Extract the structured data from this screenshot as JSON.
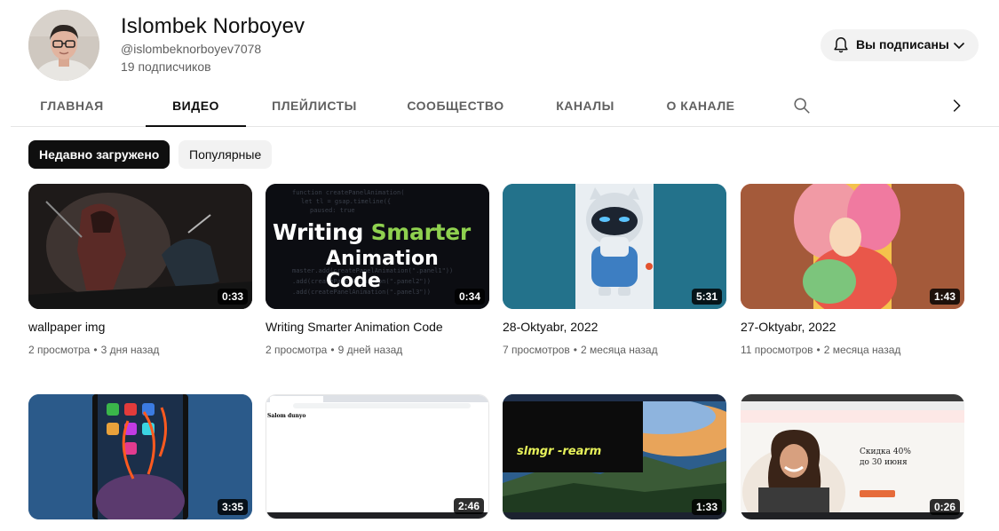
{
  "channel": {
    "name": "Islombek Norboyev",
    "handle": "@islombeknorboyev7078",
    "subscribers": "19 подписчиков",
    "subscribed_label": "Вы подписаны"
  },
  "tabs": [
    {
      "label": "ГЛАВНАЯ",
      "active": false
    },
    {
      "label": "ВИДЕО",
      "active": true
    },
    {
      "label": "ПЛЕЙЛИСТЫ",
      "active": false
    },
    {
      "label": "СООБЩЕСТВО",
      "active": false
    },
    {
      "label": "КАНАЛЫ",
      "active": false
    },
    {
      "label": "О КАНАЛЕ",
      "active": false
    }
  ],
  "chips": [
    {
      "label": "Недавно загружено",
      "active": true
    },
    {
      "label": "Популярные",
      "active": false
    }
  ],
  "videos": [
    {
      "title": "wallpaper img",
      "duration": "0:33",
      "views": "2 просмотра",
      "age": "3 дня назад"
    },
    {
      "title": "Writing Smarter Animation Code",
      "duration": "0:34",
      "views": "2 просмотра",
      "age": "9 дней назад",
      "thumb_text_1": "Writing",
      "thumb_text_2": "Smarter",
      "thumb_text_3": "Animation Code"
    },
    {
      "title": "28-Oktyabr, 2022",
      "duration": "5:31",
      "views": "7 просмотров",
      "age": "2 месяца назад"
    },
    {
      "title": "27-Oktyabr, 2022",
      "duration": "1:43",
      "views": "11 просмотров",
      "age": "2 месяца назад"
    },
    {
      "duration": "3:35"
    },
    {
      "duration": "2:46",
      "thumb_text": "Salom dunyo"
    },
    {
      "duration": "1:33",
      "thumb_text": "slmgr -rearm"
    },
    {
      "duration": "0:26",
      "thumb_text_1": "Скидка 40%",
      "thumb_text_2": "до 30 июня"
    }
  ],
  "colors": {
    "accent": "#0f0f0f",
    "muted": "#606060",
    "chip_bg": "#f2f2f2",
    "code_green": "#8fd14f"
  },
  "icons": {
    "bell": "bell-icon",
    "chevron": "chevron-down-icon",
    "search": "search-icon",
    "next": "chevron-right-icon"
  }
}
